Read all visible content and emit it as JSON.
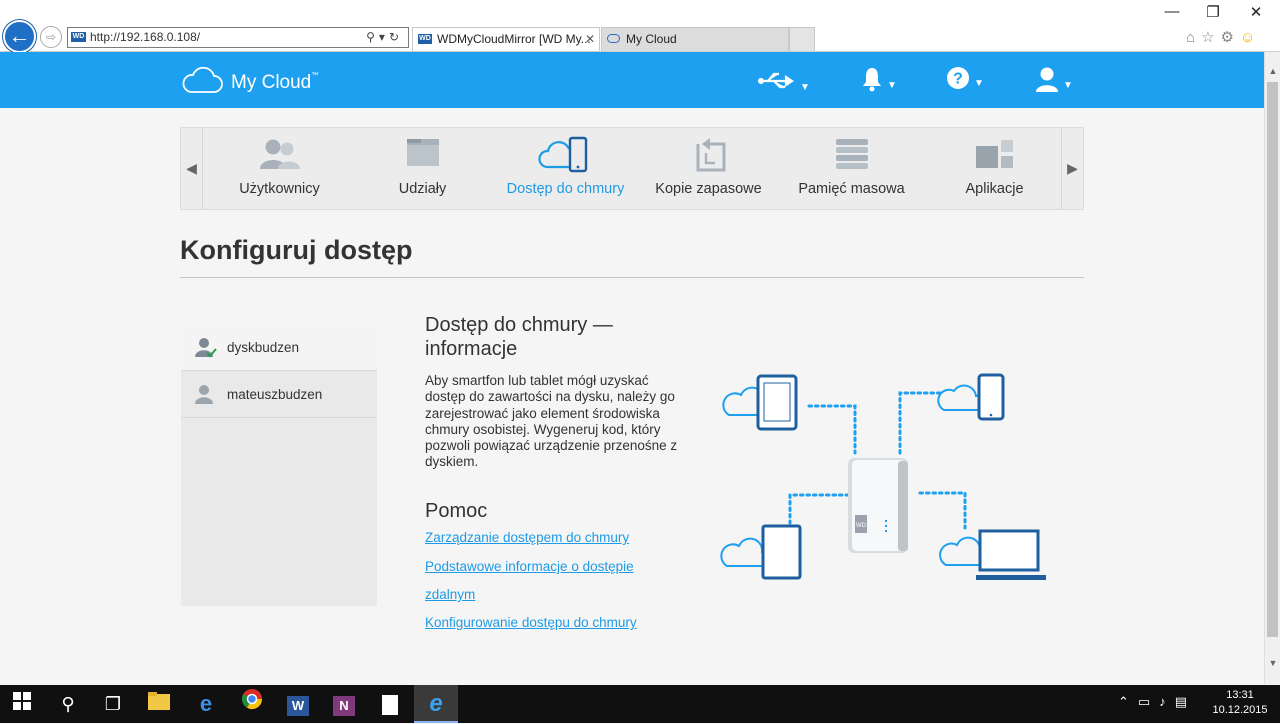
{
  "browser": {
    "address": "http://192.168.0.108/",
    "address_badge": "WD",
    "tabs": [
      {
        "label": "WDMyCloudMirror [WD My...",
        "close": "✕"
      },
      {
        "label": "My Cloud"
      }
    ],
    "window": {
      "minimize": "—",
      "restore": "❐",
      "close": "✕"
    }
  },
  "header": {
    "brand": "My Cloud",
    "brand_tm": "™",
    "bg_color": "#1ea0f0",
    "icons": [
      "usb-icon",
      "bell-icon",
      "help-icon",
      "user-icon"
    ]
  },
  "nav": {
    "items": [
      {
        "label": "Użytkownicy",
        "icon": "users-icon"
      },
      {
        "label": "Udziały",
        "icon": "folder-icon"
      },
      {
        "label": "Dostęp do chmury",
        "icon": "cloud-phone-icon",
        "active": true
      },
      {
        "label": "Kopie zapasowe",
        "icon": "backup-icon"
      },
      {
        "label": "Pamięć masowa",
        "icon": "storage-icon"
      },
      {
        "label": "Aplikacje",
        "icon": "apps-icon"
      }
    ]
  },
  "page": {
    "title": "Konfiguruj dostęp"
  },
  "users": [
    {
      "name": "dyskbudzen",
      "selected": true
    },
    {
      "name": "mateuszbudzen"
    }
  ],
  "info": {
    "heading": "Dostęp do chmury — informacje",
    "body": "Aby smartfon lub tablet mógł uzyskać dostęp do zawartości na dysku, należy go zarejestrować jako element środowiska chmury osobistej. Wygeneruj kod, który pozwoli powiązać urządzenie przenośne z dyskiem.",
    "help_title": "Pomoc",
    "links": [
      "Zarządzanie dostępem do chmury",
      "Podstawowe informacje o dostępie",
      "zdalnym",
      "Konfigurowanie dostępu do chmury"
    ]
  },
  "taskbar": {
    "time": "13:31",
    "date": "10.12.2015"
  },
  "colors": {
    "accent": "#1ea0f0",
    "link": "#1e9be6",
    "device": "#1e5fa0"
  }
}
